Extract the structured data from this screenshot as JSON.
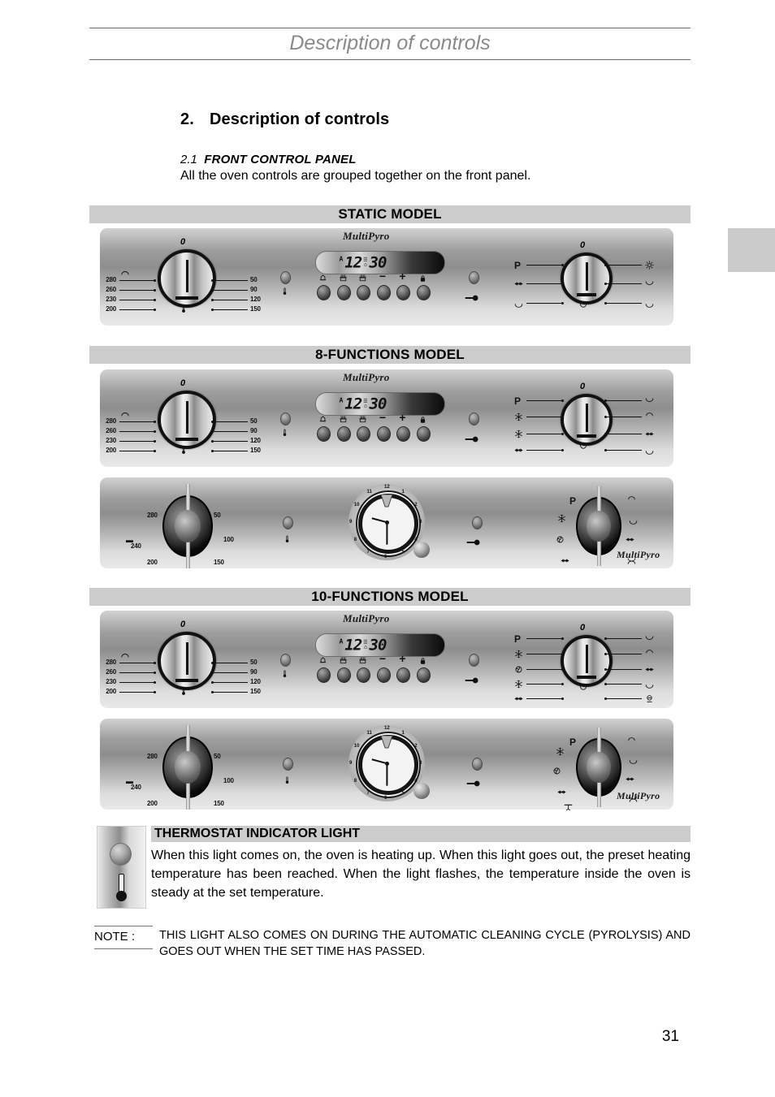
{
  "header": {
    "running_title": "Description of controls"
  },
  "section": {
    "number": "2.",
    "title": "Description of controls",
    "sub_number": "2.1",
    "sub_title": "FRONT CONTROL PANEL",
    "intro": "All the oven controls are grouped together on the front panel."
  },
  "bands": {
    "static": "STATIC MODEL",
    "eight": "8-FUNCTIONS MODEL",
    "ten": "10-FUNCTIONS MODEL"
  },
  "panel_common": {
    "brand": "MultiPyro",
    "lcd": {
      "auto": "A",
      "hours": "12",
      "minutes": "30",
      "top_icon": "☰",
      "bottom_icon": "⌂"
    },
    "zero": "0",
    "pyro": "P",
    "buttons": [
      {
        "name": "timer-bell-button",
        "icon": "bell"
      },
      {
        "name": "cooking-time-button",
        "icon": "pot-time"
      },
      {
        "name": "end-time-button",
        "icon": "pot-end"
      },
      {
        "name": "minus-button",
        "icon": "minus",
        "label": "−"
      },
      {
        "name": "plus-button",
        "icon": "plus",
        "label": "+"
      },
      {
        "name": "lock-button",
        "icon": "lock"
      }
    ],
    "key_icon": "key",
    "thermostat_lamp": "lamp",
    "thermometer": "thermometer"
  },
  "thermostat_dial": {
    "left_labels": [
      "280",
      "260",
      "230",
      "200"
    ],
    "right_labels": [
      "50",
      "90",
      "120",
      "150"
    ]
  },
  "analog_thermostat_dial": {
    "left_labels": [
      "280",
      "240",
      "200"
    ],
    "right_labels": [
      "50",
      "100",
      "150"
    ]
  },
  "function_dial_static": {
    "left": [
      "P",
      "grill-fan",
      "bottom-heat"
    ],
    "right": [
      "lamp",
      "top-bottom-heat",
      "bottom-only"
    ]
  },
  "function_dial_8": {
    "left": [
      "P",
      "defrost",
      "fan-bottom",
      "grill-fan"
    ],
    "right": [
      "convection",
      "top-heat",
      "grill-turnspit",
      "bottom-heat"
    ]
  },
  "function_dial_10": {
    "left": [
      "P",
      "defrost",
      "fan",
      "fan-bottom",
      "grill-fan"
    ],
    "right": [
      "convection",
      "top-heat",
      "grill-turnspit",
      "bottom-heat",
      "pizza"
    ]
  },
  "analog_clock": {
    "numbers": [
      "12",
      "1",
      "2",
      "3",
      "4",
      "5",
      "6",
      "7",
      "8",
      "9",
      "10",
      "11"
    ],
    "time_shown": "9:30"
  },
  "analog_function_dial": {
    "left": [
      "P",
      "defrost",
      "fan",
      "grill-fan",
      "turnspit"
    ],
    "right": [
      "top-heat",
      "bottom-heat",
      "grill-turnspit",
      "static"
    ]
  },
  "thermostat": {
    "heading": "THERMOSTAT INDICATOR LIGHT",
    "body": "When this light comes on, the oven is heating up. When this light goes out, the preset heating temperature has been reached. When the light flashes, the temperature inside the oven is steady at the set temperature."
  },
  "note": {
    "label": "NOTE :",
    "text": "THIS LIGHT ALSO COMES ON DURING THE AUTOMATIC CLEANING CYCLE (PYROLYSIS) AND GOES OUT WHEN THE SET TIME HAS PASSED."
  },
  "footer": {
    "page_number": "31"
  }
}
